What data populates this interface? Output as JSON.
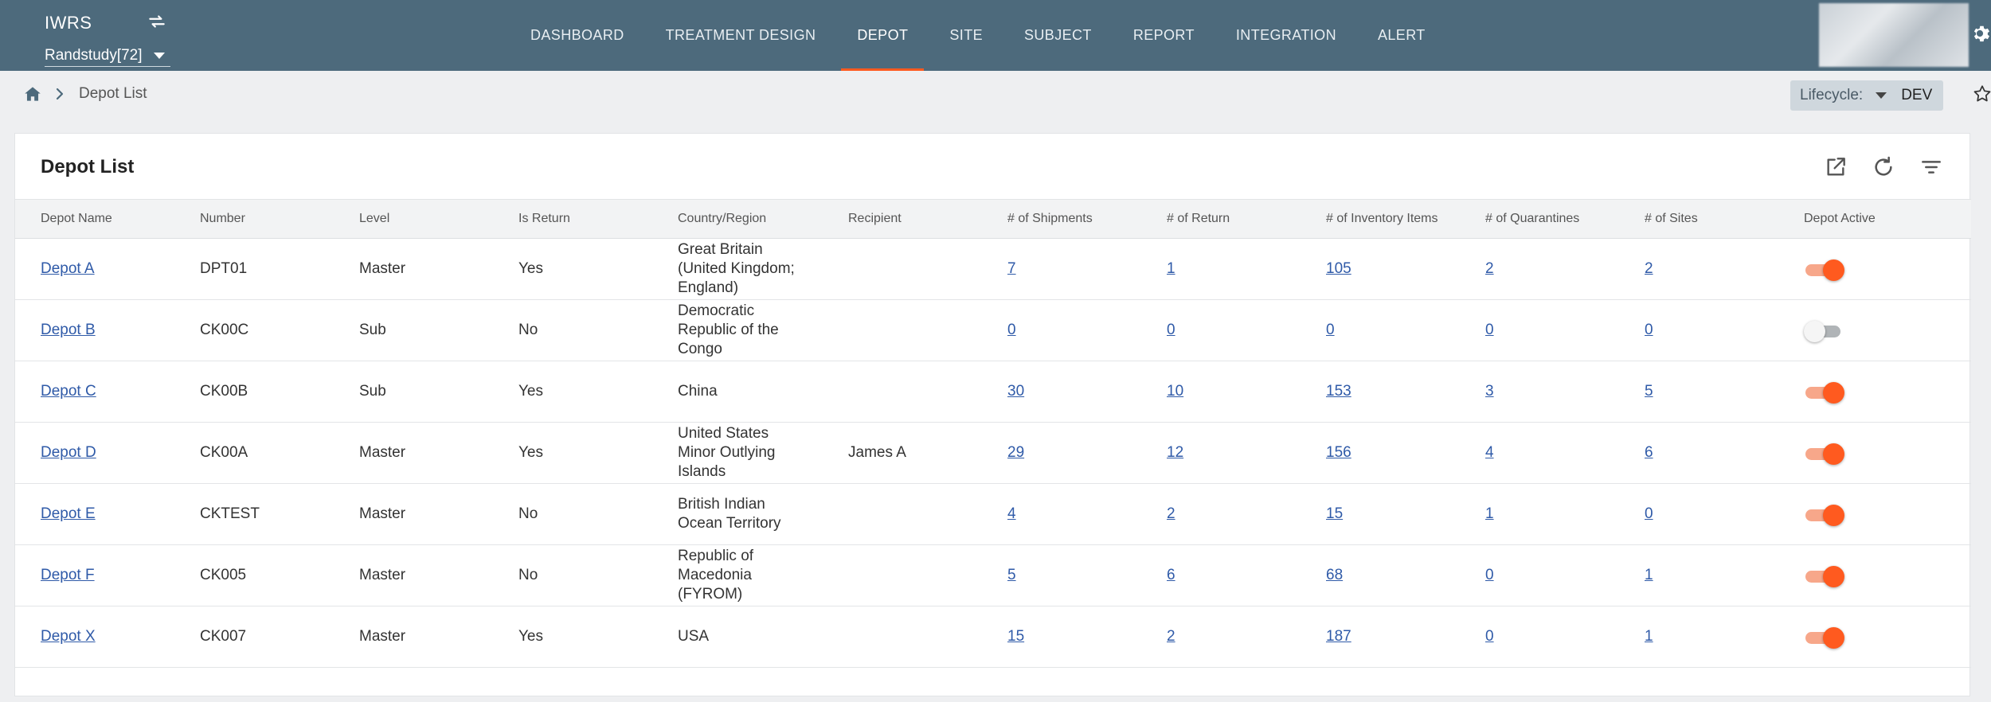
{
  "app": {
    "brand": "IWRS",
    "study": "Randstudy[72]"
  },
  "nav": [
    {
      "label": "DASHBOARD",
      "active": false
    },
    {
      "label": "TREATMENT DESIGN",
      "active": false
    },
    {
      "label": "DEPOT",
      "active": true
    },
    {
      "label": "SITE",
      "active": false
    },
    {
      "label": "SUBJECT",
      "active": false
    },
    {
      "label": "REPORT",
      "active": false
    },
    {
      "label": "INTEGRATION",
      "active": false
    },
    {
      "label": "ALERT",
      "active": false
    }
  ],
  "breadcrumb": {
    "current": "Depot List"
  },
  "lifecycle": {
    "label": "Lifecycle:",
    "value": "DEV"
  },
  "card": {
    "title": "Depot List"
  },
  "table": {
    "columns": [
      "Depot Name",
      "Number",
      "Level",
      "Is Return",
      "Country/Region",
      "Recipient",
      "# of Shipments",
      "# of Return",
      "# of Inventory Items",
      "# of Quarantines",
      "# of Sites",
      "Depot Active"
    ],
    "rows": [
      {
        "name": "Depot A",
        "number": "DPT01",
        "level": "Master",
        "is_return": "Yes",
        "country": "Great Britain (United Kingdom; England)",
        "recipient": "",
        "shipments": "7",
        "returns": "1",
        "inventory": "105",
        "quarantines": "2",
        "sites": "2",
        "active": true
      },
      {
        "name": "Depot B",
        "number": "CK00C",
        "level": "Sub",
        "is_return": "No",
        "country": "Democratic Republic of the Congo",
        "recipient": "",
        "shipments": "0",
        "returns": "0",
        "inventory": "0",
        "quarantines": "0",
        "sites": "0",
        "active": false
      },
      {
        "name": "Depot C",
        "number": "CK00B",
        "level": "Sub",
        "is_return": "Yes",
        "country": "China",
        "recipient": "",
        "shipments": "30",
        "returns": "10",
        "inventory": "153",
        "quarantines": "3",
        "sites": "5",
        "active": true
      },
      {
        "name": "Depot D",
        "number": "CK00A",
        "level": "Master",
        "is_return": "Yes",
        "country": "United States Minor Outlying Islands",
        "recipient": "James A",
        "shipments": "29",
        "returns": "12",
        "inventory": "156",
        "quarantines": "4",
        "sites": "6",
        "active": true
      },
      {
        "name": "Depot E",
        "number": "CKTEST",
        "level": "Master",
        "is_return": "No",
        "country": "British Indian Ocean Territory",
        "recipient": "",
        "shipments": "4",
        "returns": "2",
        "inventory": "15",
        "quarantines": "1",
        "sites": "0",
        "active": true
      },
      {
        "name": "Depot F",
        "number": "CK005",
        "level": "Master",
        "is_return": "No",
        "country": "Republic of Macedonia (FYROM)",
        "recipient": "",
        "shipments": "5",
        "returns": "6",
        "inventory": "68",
        "quarantines": "0",
        "sites": "1",
        "active": true
      },
      {
        "name": "Depot X",
        "number": "CK007",
        "level": "Master",
        "is_return": "Yes",
        "country": "USA",
        "recipient": "",
        "shipments": "15",
        "returns": "2",
        "inventory": "187",
        "quarantines": "0",
        "sites": "1",
        "active": true
      }
    ]
  },
  "icons": {
    "swap": "swap-arrows-icon",
    "home": "home-icon",
    "separator": "chevron-right-icon",
    "export": "open-in-new-icon",
    "refresh": "refresh-icon",
    "filter": "filter-icon",
    "settings": "gear-icon",
    "favorite": "star-icon"
  },
  "colors": {
    "topbar": "#4d6a7c",
    "accent": "#ff5a1f",
    "link": "#2f5aa8"
  }
}
